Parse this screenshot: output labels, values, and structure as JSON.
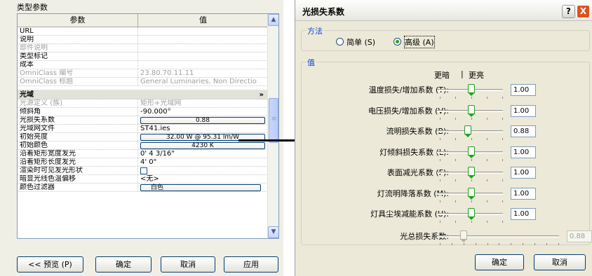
{
  "type_params": {
    "title": "类型参数",
    "header": {
      "param": "参数",
      "value": "值"
    },
    "rows_top": [
      {
        "k": "URL",
        "v": "",
        "gray": false
      },
      {
        "k": "说明",
        "v": "",
        "gray": false
      },
      {
        "k": "部件说明",
        "v": "",
        "gray": true
      },
      {
        "k": "类型标记",
        "v": "",
        "gray": false
      },
      {
        "k": "成本",
        "v": "",
        "gray": false
      },
      {
        "k": "OmniClass 编号",
        "v": "23.80.70.11.11",
        "gray": true
      },
      {
        "k": "OmniClass 标题",
        "v": "General Luminaries, Non Directio",
        "gray": true
      }
    ],
    "group_label": "光域",
    "group_chevron": "»",
    "rows_group": [
      {
        "k": "光源定义 (族)",
        "v": "矩形+光域网",
        "gray": true
      },
      {
        "k": "倾斜角",
        "v": "-90.000°",
        "gray": false
      },
      {
        "k": "光损失系数",
        "v": "0.88",
        "gray": false,
        "btn": true
      },
      {
        "k": "光域网文件",
        "v": "ST41.ies",
        "gray": false
      },
      {
        "k": "初始亮度",
        "v": "32.00 W @ 95.31 lm/W",
        "gray": false,
        "btn": true
      },
      {
        "k": "初始颜色",
        "v": "4230 K",
        "gray": false,
        "btn": true
      },
      {
        "k": "沿着矩形宽度发光",
        "v": "0'  4 3/16\"",
        "gray": false
      },
      {
        "k": "沿着矩形长度发光",
        "v": "4'  0\"",
        "gray": false
      },
      {
        "k": "渲染时可见发光形状",
        "v": "",
        "gray": false,
        "check": true
      },
      {
        "k": "暗显光线色温偏移",
        "v": "<无>",
        "gray": false
      },
      {
        "k": "颜色过滤器",
        "v": "白色",
        "gray": false,
        "color": true
      }
    ],
    "buttons": {
      "preview": "<< 预览 (P)",
      "ok": "确定",
      "cancel": "取消",
      "apply": "应用"
    }
  },
  "dialog": {
    "title": "光损失系数",
    "help": "?",
    "close": "X",
    "method_legend": "方法",
    "method_simple": "简单 (S)",
    "method_advanced": "高级 (A)",
    "method_selected": "advanced",
    "values_legend": "值",
    "dim_label": "更暗",
    "sep": "|",
    "bright_label": "更亮",
    "sliders": [
      {
        "label": "温度损失/增加系数 (T):",
        "value": "1.00",
        "pos": 0.5,
        "enabled": true
      },
      {
        "label": "电压损失/增加系数 (V):",
        "value": "1.00",
        "pos": 0.5,
        "enabled": true
      },
      {
        "label": "流明损失系数 (B):",
        "value": "0.88",
        "pos": 0.44,
        "enabled": true
      },
      {
        "label": "灯倾斜损失系数 (L):",
        "value": "1.00",
        "pos": 0.5,
        "enabled": true
      },
      {
        "label": "表面减光系数 (F):",
        "value": "1.00",
        "pos": 0.5,
        "enabled": true
      },
      {
        "label": "灯流明降落系数 (M):",
        "value": "1.00",
        "pos": 0.5,
        "enabled": true
      },
      {
        "label": "灯具尘埃减能系数 (U):",
        "value": "1.00",
        "pos": 0.5,
        "enabled": true
      }
    ],
    "total": {
      "label": "光总损失系数:",
      "value": "0.88",
      "pos": 0.2
    },
    "ok": "确定",
    "cancel": "取消"
  },
  "colors": {
    "accent": "#0046d5",
    "thumb": "#21a121",
    "close": "#e0511f"
  }
}
